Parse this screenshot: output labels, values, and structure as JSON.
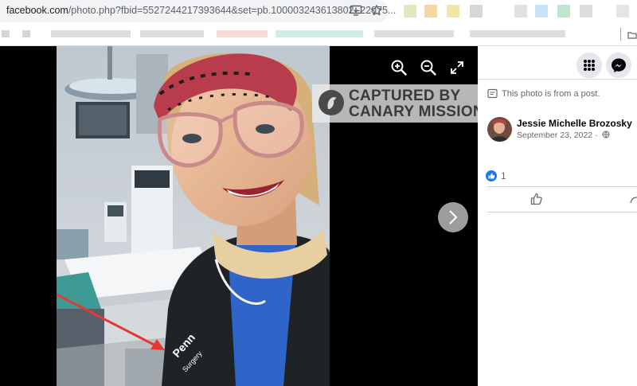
{
  "browser": {
    "url_host": "facebook.com",
    "url_path": "/photo.php?fbid=5527244217393644&set=pb.100003243613802.-22075..."
  },
  "viewer": {
    "watermark_line1": "CAPTURED BY",
    "watermark_line2": "CANARY MISSION",
    "controls": [
      "zoom-in-icon",
      "zoom-out-icon",
      "fullscreen-icon",
      "next-photo-icon"
    ]
  },
  "panel": {
    "post_note": "This photo is from a post.",
    "author_name": "Jessie Michelle Brozosky",
    "post_date": "September 23, 2022 ·",
    "like_count": "1"
  },
  "colors": {
    "facebook_blue": "#1877f2",
    "annotation_arrow": "#e53935",
    "viewer_bg": "#000000"
  }
}
